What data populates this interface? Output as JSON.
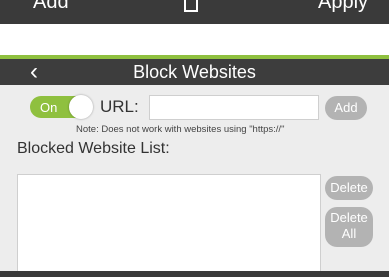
{
  "top_bar": {
    "add_label": "Add",
    "apply_label": "Apply"
  },
  "header": {
    "back_icon": "‹",
    "title": "Block Websites"
  },
  "toggle": {
    "label": "On",
    "state": "on"
  },
  "url": {
    "label": "URL:",
    "value": ""
  },
  "buttons": {
    "add": "Add",
    "delete": "Delete",
    "delete_all_line1": "Delete",
    "delete_all_line2": "All"
  },
  "note": "Note: Does not work with websites using \"https://\"",
  "list": {
    "label": "Blocked Website List:"
  },
  "colors": {
    "accent": "#8fc03f",
    "header_bg": "#3d3d3d",
    "button_bg": "#b3b3b3",
    "panel_bg": "#ededed"
  }
}
